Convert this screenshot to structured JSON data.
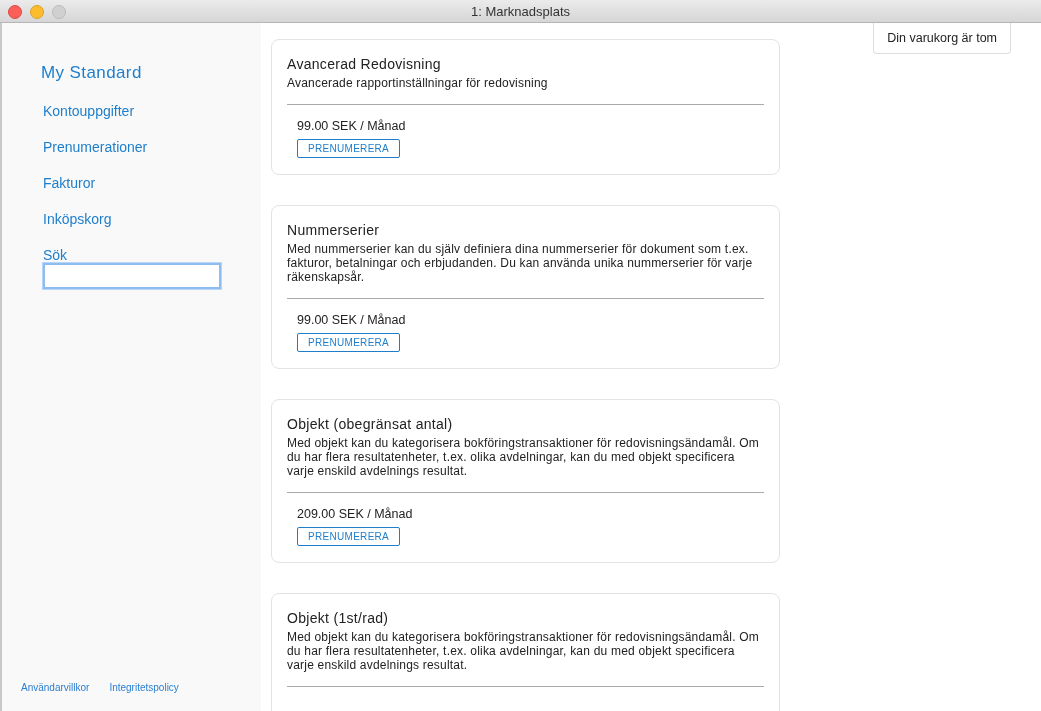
{
  "window": {
    "title": "1: Marknadsplats"
  },
  "sidebar": {
    "title": "My Standard",
    "items": [
      {
        "label": "Kontouppgifter"
      },
      {
        "label": "Prenumerationer"
      },
      {
        "label": "Fakturor"
      },
      {
        "label": "Inköpskorg"
      }
    ],
    "search": {
      "label": "Sök",
      "focused": true
    },
    "footer_links": [
      "Användarvillkor",
      "Integritetspolicy"
    ]
  },
  "cart": {
    "label": "Din varukorg är tom"
  },
  "products": [
    {
      "title": "Avancerad Redovisning",
      "description": "Avancerade rapportinställningar för redovisning",
      "price": "99.00 SEK / Månad",
      "button": "PRENUMERERA"
    },
    {
      "title": "Nummerserier",
      "description": "Med nummerserier kan du själv definiera dina nummerserier för dokument som t.ex. fakturor, betalningar och erbjudanden. Du kan använda unika nummerserier för varje räkenskapsår.",
      "price": "99.00 SEK / Månad",
      "button": "PRENUMERERA"
    },
    {
      "title": "Objekt (obegränsat antal)",
      "description": "Med objekt kan du kategorisera bokföringstransaktioner för redovisningsändamål. Om du har flera resultatenheter, t.ex. olika avdelningar, kan du med objekt specificera varje enskild avdelnings resultat.",
      "price": "209.00 SEK / Månad",
      "button": "PRENUMERERA"
    },
    {
      "title": "Objekt (1st/rad)",
      "description": "Med objekt kan du kategorisera bokföringstransaktioner för redovisningsändamål. Om du har flera resultatenheter, t.ex. olika avdelningar, kan du med objekt specificera varje enskild avdelnings resultat."
    }
  ]
}
